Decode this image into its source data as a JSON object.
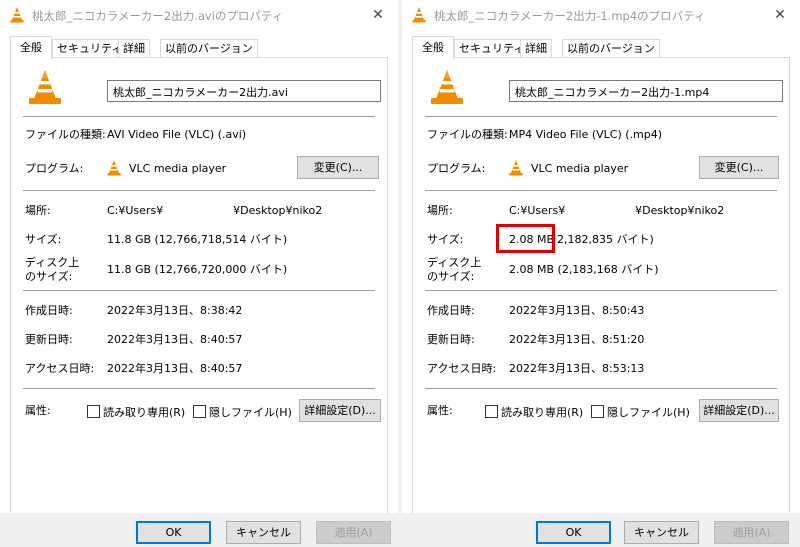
{
  "common": {
    "tabs": [
      "全般",
      "セキュリティ",
      "詳細",
      "以前のバージョン"
    ],
    "labels": {
      "file_type": "ファイルの種類:",
      "program": "プログラム:",
      "location": "場所:",
      "size": "サイズ:",
      "disk_size_line1": "ディスク上",
      "disk_size_line2": "のサイズ:",
      "created": "作成日時:",
      "modified": "更新日時:",
      "accessed": "アクセス日時:",
      "attributes": "属性:"
    },
    "change_button": "変更(C)...",
    "readonly_checkbox": "読み取り専用(R)",
    "hidden_checkbox": "隠しファイル(H)",
    "advanced_button": "詳細設定(D)...",
    "ok_button": "OK",
    "cancel_button": "キャンセル",
    "apply_button": "適用(A)",
    "close_glyph": "✕",
    "icon": "vlc-cone-icon",
    "highlight_color": "#e00000"
  },
  "left": {
    "title": "桃太郎_ニコカラメーカー2出力.aviのプロパティ",
    "filename": "桃太郎_ニコカラメーカー2出力.avi",
    "file_type": "AVI Video File (VLC) (.avi)",
    "program": "VLC media player",
    "location": "C:¥Users¥                    ¥Desktop¥niko2",
    "size": "11.8 GB (12,766,718,514 バイト)",
    "disk_size": "11.8 GB (12,766,720,000 バイト)",
    "created": "2022年3月13日、8:38:42",
    "modified": "2022年3月13日、8:40:57",
    "accessed": "2022年3月13日、8:40:57"
  },
  "right": {
    "title": "桃太郎_ニコカラメーカー2出力-1.mp4のプロパティ",
    "filename": "桃太郎_ニコカラメーカー2出力-1.mp4",
    "file_type": "MP4 Video File (VLC) (.mp4)",
    "program": "VLC media player",
    "location": "C:¥Users¥                    ¥Desktop¥niko2",
    "size_highlight": "2.08 MB",
    "size_rest": "2,182,835 バイト)",
    "disk_size": "2.08 MB (2,183,168 バイト)",
    "created": "2022年3月13日、8:50:43",
    "modified": "2022年3月13日、8:51:20",
    "accessed": "2022年3月13日、8:53:13"
  }
}
